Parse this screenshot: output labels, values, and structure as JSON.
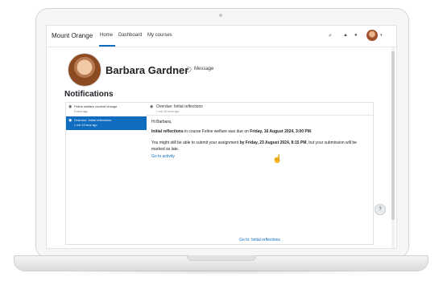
{
  "navbar": {
    "brand": "Mount Orange",
    "links": [
      "Home",
      "Dashboard",
      "My courses"
    ],
    "search_icon": "search-icon",
    "bell_icon": "bell-icon",
    "messages_icon": "chat-icon"
  },
  "profile": {
    "name": "Barbara Gardner",
    "message_label": "Message"
  },
  "section": {
    "title": "Notifications"
  },
  "notifications": [
    {
      "title": "Feline welfare content change",
      "time": "5 secs ago",
      "selected": false
    },
    {
      "title": "Overdue: Initial reflections",
      "time": "1 min 15 secs ago",
      "selected": true
    }
  ],
  "detail": {
    "title": "Overdue: Initial reflections",
    "time": "1 min 15 secs ago",
    "greeting": "Hi Barbara,",
    "line1_bold1": "Initial reflections",
    "line1_text1": " in course Feline welfare was due on ",
    "line1_bold2": "Friday, 16 August 2024, 3:00 PM",
    "line1_text2": ".",
    "line2_text1": "You might still be able to submit your assignment ",
    "line2_bold": "by Friday, 23 August 2024, 8:15 PM",
    "line2_text2": ", but your submission will be marked as late.",
    "action_link": "Go to activity",
    "bottom_link": "Go to: Initial reflections"
  },
  "help_label": "?",
  "colors": {
    "accent": "#0f6cbf",
    "text": "#1d2125"
  }
}
